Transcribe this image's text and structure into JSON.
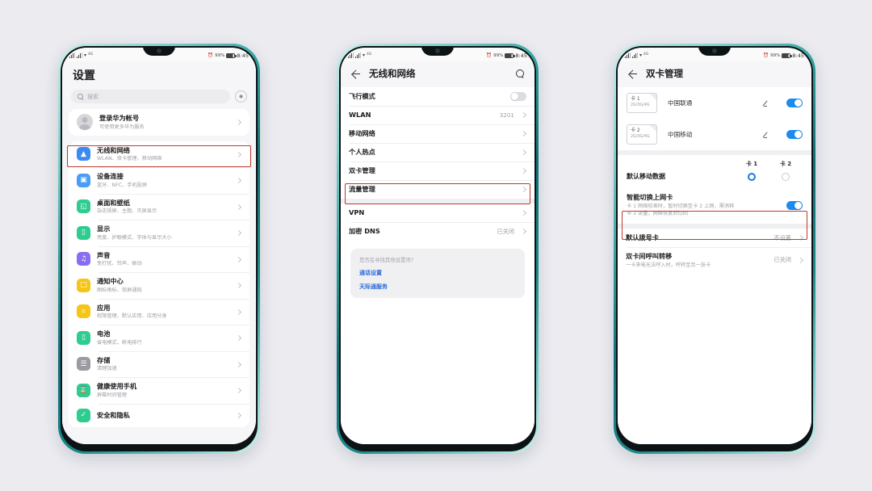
{
  "statusbar": {
    "battery": "99%",
    "time": "8:45",
    "signal_label": "4G"
  },
  "phone1": {
    "title": "设置",
    "search": {
      "placeholder": "搜索",
      "voice_icon": "voice-assistant-icon"
    },
    "account": {
      "title": "登录华为帐号",
      "subtitle": "可使用更多华为服务"
    },
    "items": [
      {
        "title": "无线和网络",
        "subtitle": "WLAN、双卡管理、移动网络",
        "icon": "wifi-icon",
        "color": "#3d8bf2",
        "highlighted": true
      },
      {
        "title": "设备连接",
        "subtitle": "蓝牙、NFC、手机投屏",
        "icon": "device-connect-icon",
        "color": "#4a9df5",
        "highlighted": false
      },
      {
        "title": "桌面和壁纸",
        "subtitle": "杂志锁屏、主题、灭屏显示",
        "icon": "wallpaper-icon",
        "color": "#2ecc8f",
        "highlighted": false
      },
      {
        "title": "显示",
        "subtitle": "亮度、护眼模式、字体与显示大小",
        "icon": "display-icon",
        "color": "#2ecc8f",
        "highlighted": false
      },
      {
        "title": "声音",
        "subtitle": "免打扰、铃声、振动",
        "icon": "sound-icon",
        "color": "#8a6df0",
        "highlighted": false
      },
      {
        "title": "通知中心",
        "subtitle": "图标角标、锁屏通知",
        "icon": "notification-icon",
        "color": "#f5c518",
        "highlighted": false
      },
      {
        "title": "应用",
        "subtitle": "权限管理、默认应用、应用分身",
        "icon": "apps-icon",
        "color": "#f5c518",
        "highlighted": false
      },
      {
        "title": "电池",
        "subtitle": "省电模式、耗电排行",
        "icon": "battery-icon",
        "color": "#2ecc8f",
        "highlighted": false
      },
      {
        "title": "存储",
        "subtitle": "清理加速",
        "icon": "storage-icon",
        "color": "#9a9aa2",
        "highlighted": false
      },
      {
        "title": "健康使用手机",
        "subtitle": "屏幕时间管理",
        "icon": "digital-balance-icon",
        "color": "#2ecc8f",
        "highlighted": false
      },
      {
        "title": "安全和隐私",
        "subtitle": "",
        "icon": "security-icon",
        "color": "#2ecc8f",
        "highlighted": false
      }
    ]
  },
  "phone2": {
    "nav_title": "无线和网络",
    "back_icon": "back-arrow-icon",
    "search_icon": "search-icon",
    "items": [
      {
        "title": "飞行模式",
        "value": "",
        "toggle": "off",
        "chevron": false,
        "highlighted": false
      },
      {
        "title": "WLAN",
        "value": "3201",
        "toggle": null,
        "chevron": true,
        "highlighted": false
      },
      {
        "title": "移动网络",
        "value": "",
        "toggle": null,
        "chevron": true,
        "highlighted": false
      },
      {
        "title": "个人热点",
        "value": "",
        "toggle": null,
        "chevron": true,
        "highlighted": false
      },
      {
        "title": "双卡管理",
        "value": "",
        "toggle": null,
        "chevron": true,
        "highlighted": true
      },
      {
        "title": "流量管理",
        "value": "",
        "toggle": null,
        "chevron": true,
        "highlighted": false
      }
    ],
    "items2": [
      {
        "title": "VPN",
        "value": "",
        "chevron": true
      },
      {
        "title": "加密 DNS",
        "value": "已关闭",
        "chevron": true
      }
    ],
    "suggestion": {
      "question": "是否在寻找其他设置项?",
      "links": [
        "通话设置",
        "天际通服务"
      ]
    }
  },
  "phone3": {
    "nav_title": "双卡管理",
    "back_icon": "back-arrow-icon",
    "sims": [
      {
        "slot": "卡 1",
        "tech": "2G/3G/4G",
        "carrier": "中国联通",
        "edit_icon": "pencil-icon",
        "toggle": "on"
      },
      {
        "slot": "卡 2",
        "tech": "2G/3G/4G",
        "carrier": "中国移动",
        "edit_icon": "pencil-icon",
        "toggle": "on"
      }
    ],
    "columns": [
      "卡 1",
      "卡 2"
    ],
    "default_data": {
      "label": "默认移动数据",
      "selected": 0
    },
    "smart_switch": {
      "title": "智能切换上网卡",
      "subtitle_line1": "卡 1 网络较差时，暂时切换至卡 2 上网，需消耗",
      "subtitle_line2": "卡 2 流量，网络恢复后切回",
      "toggle": "on",
      "highlighted": true
    },
    "rows": [
      {
        "title": "默认拨号卡",
        "subtitle": "",
        "value": "不设置",
        "chevron": true
      },
      {
        "title": "双卡间呼叫转移",
        "subtitle": "一卡来电无法呼入时，呼转至另一张卡",
        "value": "已关闭",
        "chevron": true
      }
    ]
  },
  "colors": {
    "accent": "#1a8cf0",
    "highlight": "#c0392b",
    "frame": "#1a8a8b",
    "background": "#ebebf0"
  }
}
